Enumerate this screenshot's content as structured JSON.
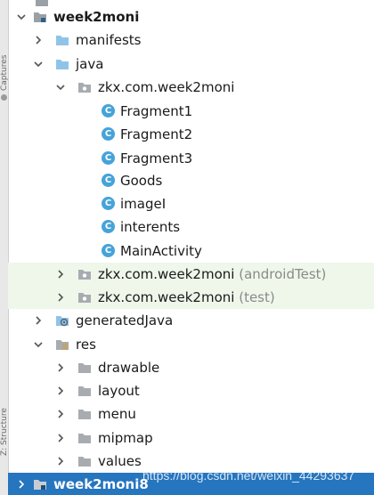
{
  "side_tabs": {
    "captures": "Captures",
    "structure": "Z: Structure"
  },
  "tree": {
    "root": "week2moni",
    "manifests": "manifests",
    "java": "java",
    "main_package": "zkx.com.week2moni",
    "classes": [
      "Fragment1",
      "Fragment2",
      "Fragment3",
      "Goods",
      "imageI",
      "interents",
      "MainActivity"
    ],
    "android_test_package": "zkx.com.week2moni",
    "android_test_suffix": "(androidTest)",
    "test_package": "zkx.com.week2moni",
    "test_suffix": "(test)",
    "generated_java": "generatedJava",
    "res": "res",
    "res_children": [
      "drawable",
      "layout",
      "menu",
      "mipmap",
      "values"
    ],
    "selected_module": "week2moni8"
  },
  "watermark": "https://blog.csdn.net/weixin_44293637",
  "colors": {
    "selection": "#2675bf",
    "highlight_row": "#eef7ea",
    "folder": "#8fc4e8",
    "class_icon": "#46a3d9",
    "module_icon": "#9aa0a6"
  }
}
